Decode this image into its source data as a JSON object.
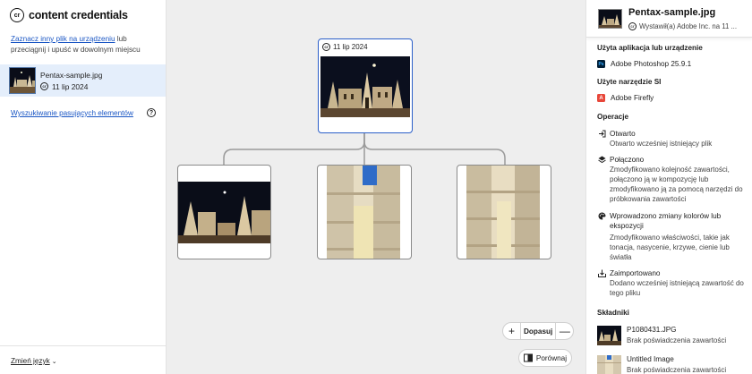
{
  "app": {
    "title": "content credentials",
    "logo_mark": "cr"
  },
  "sidebar": {
    "upload_link": "Zaznacz inny plik na urządzeniu",
    "upload_rest": " lub przeciągnij i upuść w dowolnym miejscu",
    "file": {
      "name": "Pentax-sample.jpg",
      "date": "11 lip 2024"
    },
    "search_link": "Wyszukiwanie pasujących elementów",
    "help": "?",
    "language": "Zmień język",
    "language_chevron": "⌄"
  },
  "canvas": {
    "root": {
      "date": "11 lip 2024"
    },
    "zoom": {
      "plus": "+",
      "label": "Dopasuj",
      "minus": "—"
    },
    "compare": "Porównaj"
  },
  "panel": {
    "title": "Pentax-sample.jpg",
    "issuer": "Wystawił(a) Adobe Inc. na 11 ...",
    "apps_heading": "Użyta aplikacja lub urządzenie",
    "app_name": "Adobe Photoshop 25.9.1",
    "ai_heading": "Użyte narzędzie SI",
    "ai_name": "Adobe Firefly",
    "ops_heading": "Operacje",
    "operations": [
      {
        "icon": "open-icon",
        "title": "Otwarto",
        "desc": "Otwarto wcześniej istniejący plik"
      },
      {
        "icon": "layers-icon",
        "title": "Połączono",
        "desc": "Zmodyfikowano kolejność zawartości, połączono ją w kompozycję lub zmodyfikowano ją za pomocą narzędzi do próbkowania zawartości"
      },
      {
        "icon": "palette-icon",
        "title": "Wprowadzono zmiany kolorów lub ekspozycji",
        "desc": "Zmodyfikowano właściwości, takie jak tonacja, nasycenie, krzywe, cienie lub światła"
      },
      {
        "icon": "import-icon",
        "title": "Zaimportowano",
        "desc": "Dodano wcześniej istniejącą zawartość do tego pliku"
      }
    ],
    "ingredients_heading": "Składniki",
    "ingredients": [
      {
        "name": "P1080431.JPG",
        "desc": "Brak poświadczenia zawartości"
      },
      {
        "name": "Untitled Image",
        "desc": "Brak poświadczenia zawartości"
      }
    ]
  },
  "colors": {
    "accent": "#2b5fc9",
    "link": "#1a56c4",
    "selected": "#e4eefb"
  }
}
